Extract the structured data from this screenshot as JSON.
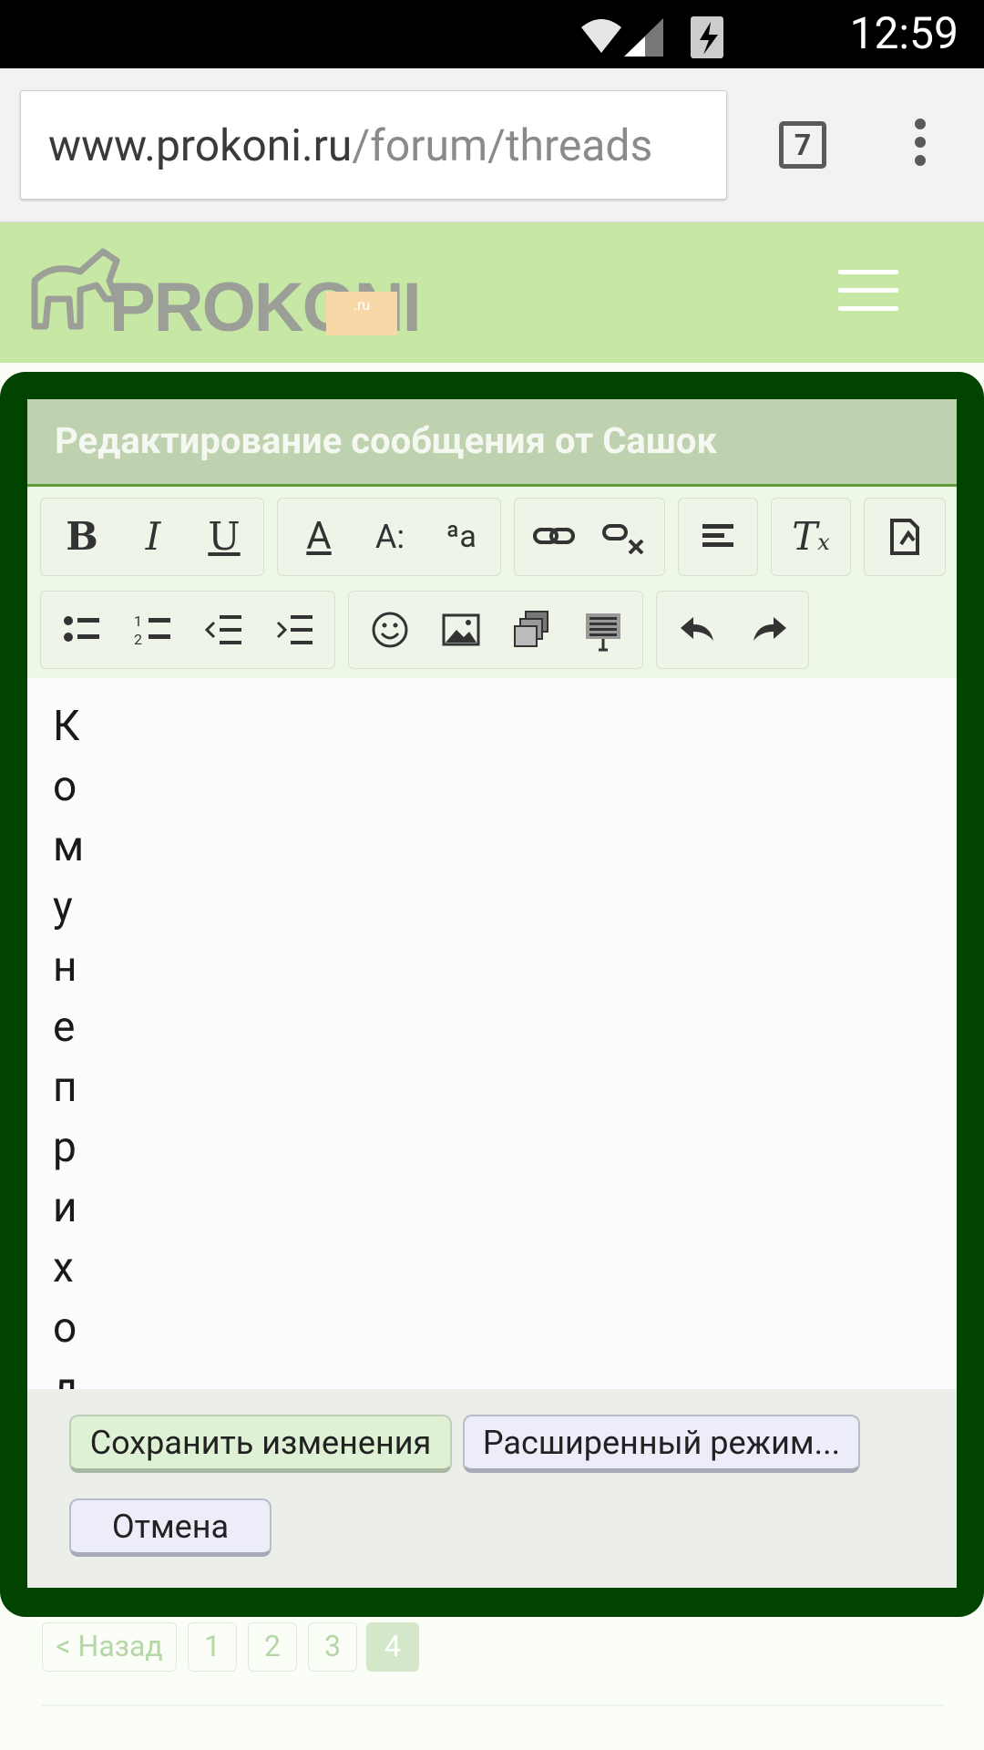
{
  "status_bar": {
    "time": "12:59"
  },
  "browser": {
    "url_domain": "www.prokoni.ru",
    "url_path": "/forum/threads",
    "tab_count": "7"
  },
  "site": {
    "logo_text": "PROKONI",
    "logo_suffix": ".ru"
  },
  "dialog": {
    "title": "Редактирование сообщения от Сашок",
    "editor_text": "Комунеприход",
    "save_label": "Сохранить изменения",
    "advanced_label": "Расширенный режим...",
    "cancel_label": "Отмена"
  },
  "toolbar": {
    "row1": [
      [
        "bold",
        "italic",
        "underline"
      ],
      [
        "text-color",
        "font-size",
        "font-family"
      ],
      [
        "link",
        "unlink"
      ],
      [
        "align"
      ],
      [
        "remove-format"
      ],
      [
        "source"
      ]
    ],
    "row2": [
      [
        "bullet-list",
        "numbered-list",
        "outdent",
        "indent"
      ],
      [
        "smiley",
        "image",
        "media",
        "code"
      ],
      [
        "undo",
        "redo"
      ]
    ]
  },
  "pagination": {
    "prev_label": "< Назад",
    "pages": [
      "1",
      "2",
      "3",
      "4"
    ],
    "current": "4"
  },
  "colors": {
    "header_green": "#c6e8a4",
    "modal_border": "#004400",
    "title_bg": "#bfd2b0"
  }
}
